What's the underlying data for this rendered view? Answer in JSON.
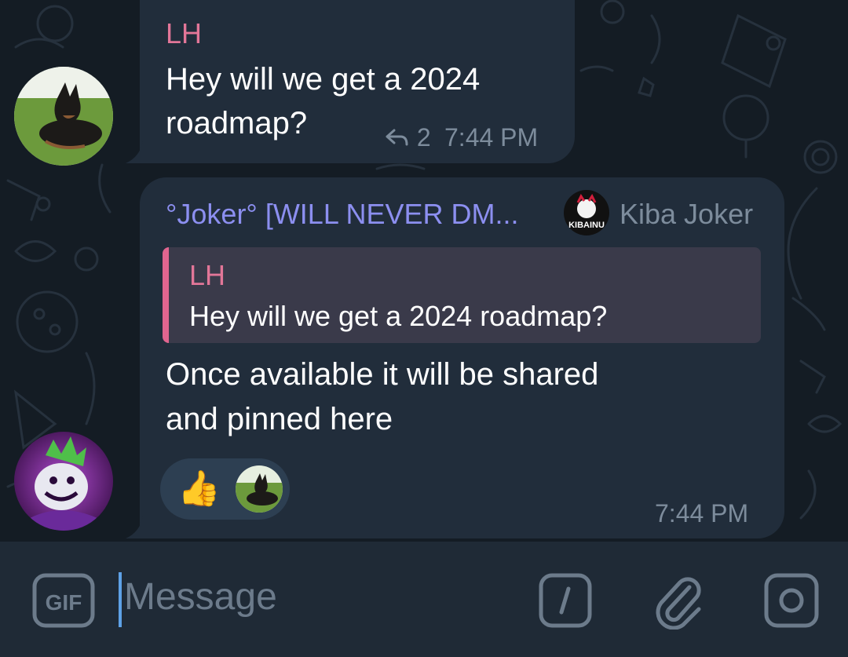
{
  "messages": [
    {
      "sender": "LH",
      "sender_color": "#e27698",
      "text_lines": [
        "Hey will we get a 2024",
        "roadmap?"
      ],
      "reply_count": "2",
      "time": "7:44 PM",
      "avatar": "doberman-dog-avatar"
    },
    {
      "sender": "°Joker° [WILL NEVER DM...",
      "sender_color": "#8c8ff0",
      "sender_title": "Kiba Joker",
      "badge_text": "KIBAINU",
      "quote": {
        "sender": "LH",
        "text": "Hey will we get a 2024 roadmap?"
      },
      "text_lines": [
        "Once available it will be shared",
        "and pinned here"
      ],
      "reaction": {
        "emoji": "👍"
      },
      "time": "7:44 PM",
      "avatar": "joker-character-avatar"
    }
  ],
  "input": {
    "placeholder": "Message",
    "gif_label": "GIF"
  },
  "icons": {
    "gif": "gif-icon",
    "command": "slash-command-icon",
    "attach": "paperclip-icon",
    "camera": "camera-circle-icon",
    "reply": "reply-arrow-icon"
  },
  "colors": {
    "background": "#141c24",
    "bubble": "#212d3b",
    "quote_bar": "#e0658f",
    "accent": "#5ea1e6"
  }
}
